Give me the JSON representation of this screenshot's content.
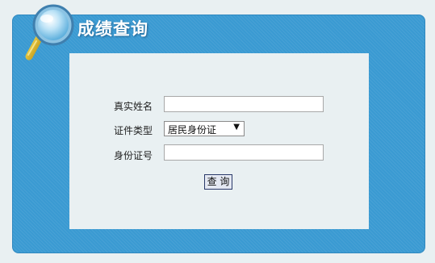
{
  "header": {
    "title": "成绩查询",
    "icon": "magnifier-icon"
  },
  "form": {
    "name_label": "真实姓名",
    "name_value": "",
    "id_type_label": "证件类型",
    "id_type_selected": "居民身份证",
    "id_number_label": "身份证号",
    "id_number_value": "",
    "submit_label": "查 询"
  },
  "colors": {
    "panel": "#3a9ad2",
    "background": "#e9f0f2",
    "title_text": "#ffffff"
  }
}
